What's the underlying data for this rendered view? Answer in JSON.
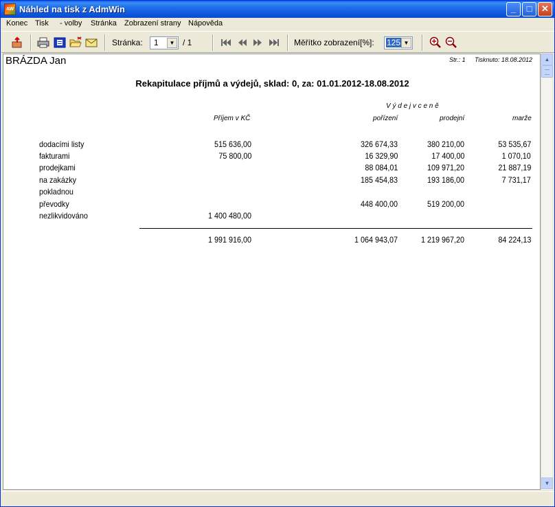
{
  "window": {
    "title": "Náhled na tisk z AdmWin",
    "minimize": "_",
    "maximize": "□",
    "close": "✕"
  },
  "menu": [
    {
      "label": "Konec"
    },
    {
      "label": "Tisk"
    },
    {
      "label": "- volby"
    },
    {
      "label": "Stránka"
    },
    {
      "label": "Zobrazení strany"
    },
    {
      "label": "Nápověda"
    }
  ],
  "toolbar": {
    "page_label": "Stránka:",
    "page_value": "1",
    "page_total": "/ 1",
    "zoom_label": "Měřítko zobrazení[%]:",
    "zoom_value": "125"
  },
  "icons": [
    "exit-icon",
    "print-icon",
    "print-options-icon",
    "open-folder-icon",
    "email-icon",
    "first-page-icon",
    "prev-page-icon",
    "next-page-icon",
    "last-page-icon",
    "zoom-in-icon",
    "zoom-out-icon"
  ],
  "document": {
    "name": "BRÁZDA Jan",
    "page_info": "Str.: 1",
    "printed": "Tisknuto: 18.08.2012",
    "title": "Rekapitulace příjmů a výdejů, sklad:  0, za: 01.01.2012-18.08.2012",
    "header_group": "V ý d e j  v  c e n ě",
    "col_income": "Příjem v KČ",
    "col_cost": "pořízení",
    "col_sale": "prodejní",
    "col_margin": "marže",
    "rows": [
      {
        "label": "dodacími listy",
        "income": "515 636,00",
        "cost": "326 674,33",
        "sale": "380 210,00",
        "margin": "53 535,67"
      },
      {
        "label": "fakturami",
        "income": "75 800,00",
        "cost": "16 329,90",
        "sale": "17 400,00",
        "margin": "1 070,10"
      },
      {
        "label": "prodejkami",
        "income": "",
        "cost": "88 084,01",
        "sale": "109 971,20",
        "margin": "21 887,19"
      },
      {
        "label": "na zakázky",
        "income": "",
        "cost": "185 454,83",
        "sale": "193 186,00",
        "margin": "7 731,17"
      },
      {
        "label": "pokladnou",
        "income": "",
        "cost": "",
        "sale": "",
        "margin": ""
      },
      {
        "label": "převodky",
        "income": "",
        "cost": "448 400,00",
        "sale": "519 200,00",
        "margin": ""
      },
      {
        "label": "nezlikvidováno",
        "income": "1 400 480,00",
        "cost": "",
        "sale": "",
        "margin": ""
      }
    ],
    "totals": {
      "income": "1 991 916,00",
      "cost": "1 064 943,07",
      "sale": "1 219 967,20",
      "margin": "84 224,13"
    }
  },
  "colors": {
    "titlebar": "#0a5fe6",
    "window_bg": "#ece9d8",
    "selection": "#316ac5"
  }
}
